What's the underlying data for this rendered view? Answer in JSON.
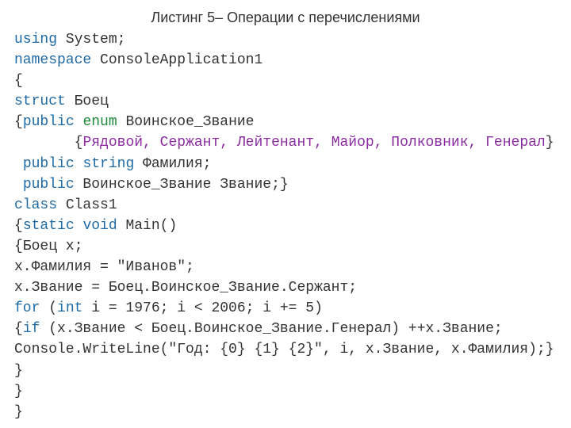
{
  "title": "Листинг 5– Операции с перечислениями",
  "code": {
    "l1_using": "using",
    "l1_rest": " System;",
    "l2_ns": "namespace",
    "l2_rest": " ConsoleApplication1",
    "l3": "{",
    "l4_struct": "struct",
    "l4_rest": " Боец",
    "l5_open": "{",
    "l5_public": "public",
    "l5_sp": " ",
    "l5_enum": "enum",
    "l5_rest": " Воинское_Звание",
    "l6_indent": "       {",
    "l6_vals": "Рядовой, Сержант, Лейтенант, Майор, Полковник, Генерал",
    "l6_close": "}",
    "l7_pre": " ",
    "l7_public": "public",
    "l7_sp": " ",
    "l7_string": "string",
    "l7_rest": " Фамилия;",
    "l8_pre": " ",
    "l8_public": "public",
    "l8_rest": " Воинское_Звание Звание;}",
    "l9_class": "class",
    "l9_rest": " Class1",
    "l10_open": "{",
    "l10_static": "static",
    "l10_sp": " ",
    "l10_void": "void",
    "l10_rest": " Main()",
    "l11": "{Боец x;",
    "l12": "x.Фамилия = \"Иванов\";",
    "l13": "x.Звание = Боец.Воинское_Звание.Сержант;",
    "l14_for": "for",
    "l14_a": " (",
    "l14_int": "int",
    "l14_b": " i = 1976; i < 2006; i += 5)",
    "l15_open": "{",
    "l15_if": "if",
    "l15_rest": " (x.Звание < Боец.Воинское_Звание.Генерал) ++x.Звание;",
    "l16": "Console.WriteLine(\"Год: {0} {1} {2}\", i, x.Звание, x.Фамилия);}",
    "l17": "}",
    "l18": "}",
    "l19": "}"
  }
}
